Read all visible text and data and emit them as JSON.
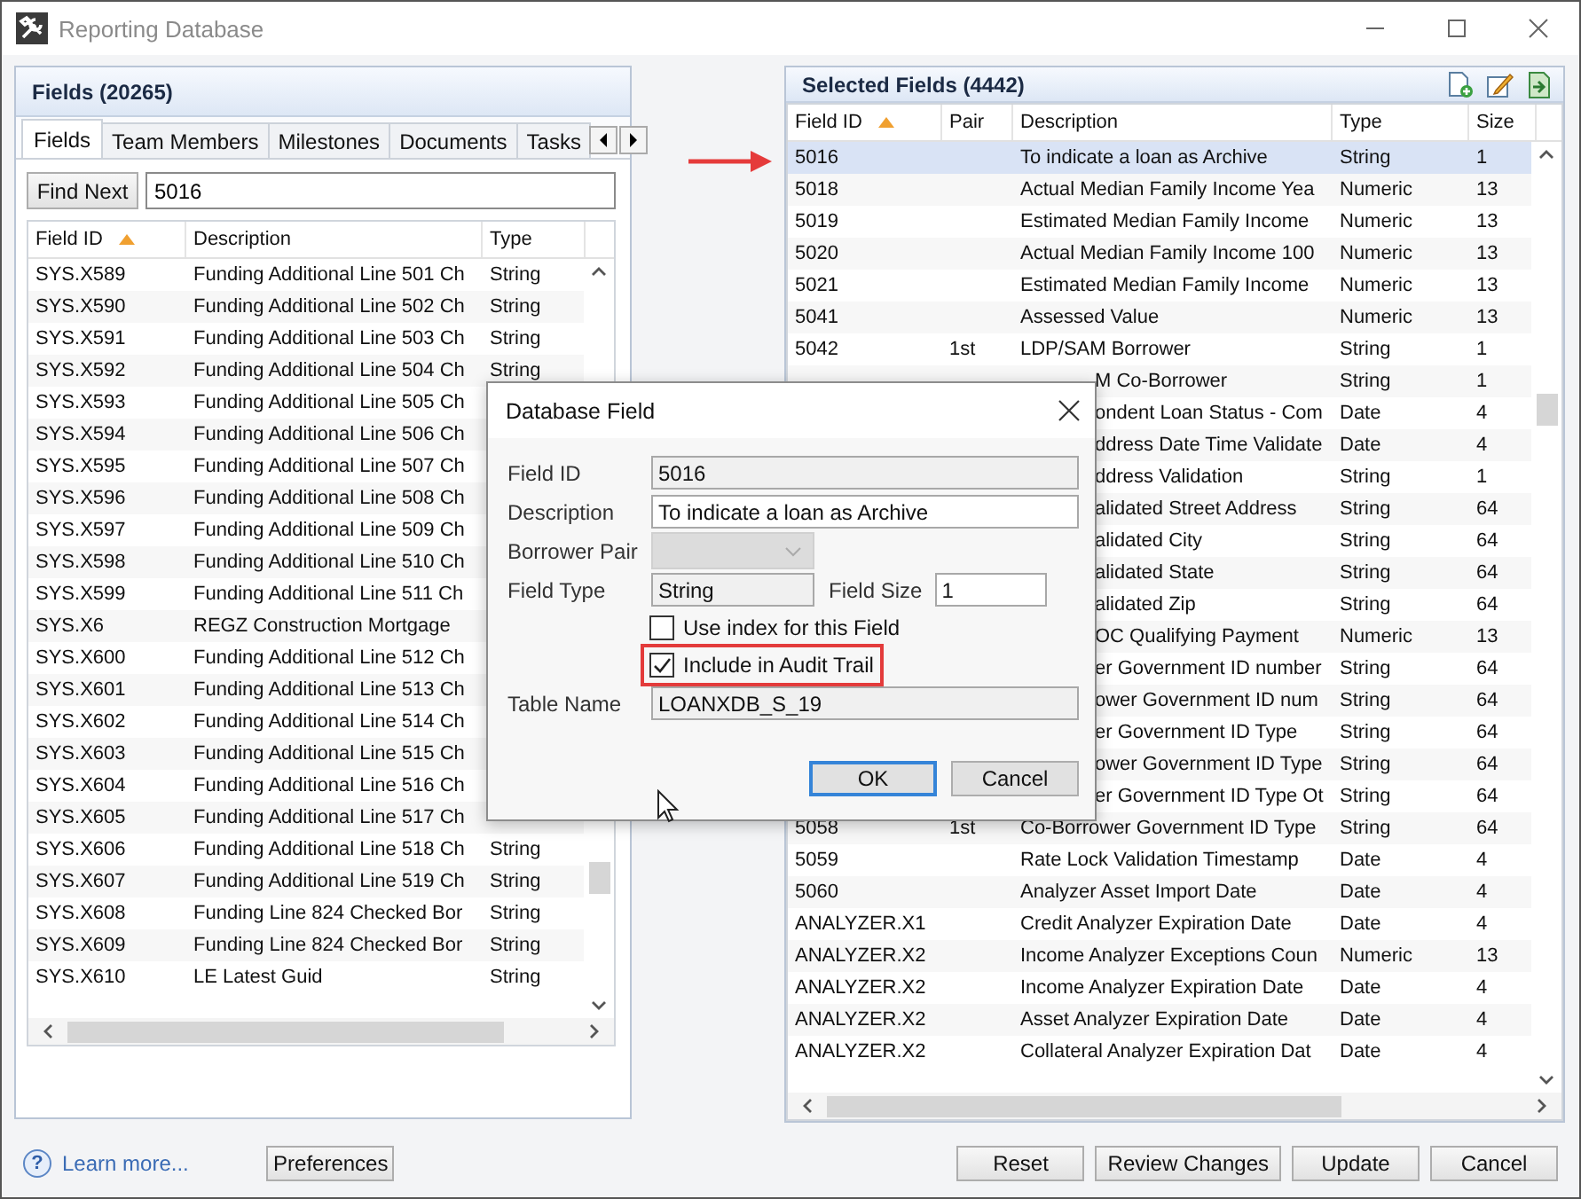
{
  "window": {
    "title": "Reporting Database"
  },
  "fields_panel": {
    "title": "Fields (20265)",
    "tabs": [
      {
        "label": "Fields",
        "selected": true
      },
      {
        "label": "Team Members",
        "selected": false
      },
      {
        "label": "Milestones",
        "selected": false
      },
      {
        "label": "Documents",
        "selected": false
      },
      {
        "label": "Tasks",
        "selected": false
      }
    ],
    "find_button": "Find Next",
    "search_value": "5016",
    "columns": [
      {
        "label": "Field ID",
        "sorted": true
      },
      {
        "label": "Description",
        "sorted": false
      },
      {
        "label": "Type",
        "sorted": false
      }
    ],
    "rows": [
      {
        "field_id": "SYS.X589",
        "description": "Funding Additional Line 501 Ch",
        "type": "String"
      },
      {
        "field_id": "SYS.X590",
        "description": "Funding Additional Line 502 Ch",
        "type": "String"
      },
      {
        "field_id": "SYS.X591",
        "description": "Funding Additional Line 503 Ch",
        "type": "String"
      },
      {
        "field_id": "SYS.X592",
        "description": "Funding Additional Line 504 Ch",
        "type": "String"
      },
      {
        "field_id": "SYS.X593",
        "description": "Funding Additional Line 505 Ch"
      },
      {
        "field_id": "SYS.X594",
        "description": "Funding Additional Line 506 Ch"
      },
      {
        "field_id": "SYS.X595",
        "description": "Funding Additional Line 507 Ch"
      },
      {
        "field_id": "SYS.X596",
        "description": "Funding Additional Line 508 Ch"
      },
      {
        "field_id": "SYS.X597",
        "description": "Funding Additional Line 509 Ch"
      },
      {
        "field_id": "SYS.X598",
        "description": "Funding Additional Line 510 Ch"
      },
      {
        "field_id": "SYS.X599",
        "description": "Funding Additional Line 511 Ch"
      },
      {
        "field_id": "SYS.X6",
        "description": "REGZ Construction Mortgage"
      },
      {
        "field_id": "SYS.X600",
        "description": "Funding Additional Line 512 Ch"
      },
      {
        "field_id": "SYS.X601",
        "description": "Funding Additional Line 513 Ch"
      },
      {
        "field_id": "SYS.X602",
        "description": "Funding Additional Line 514 Ch"
      },
      {
        "field_id": "SYS.X603",
        "description": "Funding Additional Line 515 Ch"
      },
      {
        "field_id": "SYS.X604",
        "description": "Funding Additional Line 516 Ch"
      },
      {
        "field_id": "SYS.X605",
        "description": "Funding Additional Line 517 Ch"
      },
      {
        "field_id": "SYS.X606",
        "description": "Funding Additional Line 518 Ch",
        "type": "String"
      },
      {
        "field_id": "SYS.X607",
        "description": "Funding Additional Line 519 Ch",
        "type": "String"
      },
      {
        "field_id": "SYS.X608",
        "description": "Funding Line 824 Checked Bor",
        "type": "String"
      },
      {
        "field_id": "SYS.X609",
        "description": "Funding Line 824 Checked Bor",
        "type": "String"
      },
      {
        "field_id": "SYS.X610",
        "description": "LE Latest Guid",
        "type": "String"
      }
    ]
  },
  "selected_panel": {
    "title": "Selected Fields (4442)",
    "columns": [
      {
        "label": "Field ID",
        "sorted": true
      },
      {
        "label": "Pair",
        "sorted": false
      },
      {
        "label": "Description",
        "sorted": false
      },
      {
        "label": "Type",
        "sorted": false
      },
      {
        "label": "Size",
        "sorted": false
      }
    ],
    "rows": [
      {
        "field_id": "5016",
        "description": "To indicate a loan as Archive",
        "type": "String",
        "size": "1",
        "selected": true
      },
      {
        "field_id": "5018",
        "description": "Actual Median Family Income Yea",
        "type": "Numeric",
        "size": "13",
        "selected": false
      },
      {
        "field_id": "5019",
        "description": "Estimated Median Family Income",
        "type": "Numeric",
        "size": "13",
        "selected": false
      },
      {
        "field_id": "5020",
        "description": "Actual Median Family Income 100",
        "type": "Numeric",
        "size": "13",
        "selected": false
      },
      {
        "field_id": "5021",
        "description": "Estimated Median Family Income",
        "type": "Numeric",
        "size": "13",
        "selected": false
      },
      {
        "field_id": "5041",
        "description": "Assessed Value",
        "type": "Numeric",
        "size": "13",
        "selected": false
      },
      {
        "field_id": "5042",
        "pair": "1st",
        "description": "LDP/SAM Borrower",
        "type": "String",
        "size": "1",
        "selected": false
      },
      {
        "description": "M Co-Borrower",
        "covered": true,
        "type": "String",
        "size": "1",
        "selected": false
      },
      {
        "description": "ondent Loan Status - Com",
        "covered": true,
        "type": "Date",
        "size": "4",
        "selected": false
      },
      {
        "description": "ddress Date Time Validate",
        "covered": true,
        "type": "Date",
        "size": "4",
        "selected": false
      },
      {
        "description": "ddress Validation",
        "covered": true,
        "type": "String",
        "size": "1",
        "selected": false
      },
      {
        "description": "alidated Street Address",
        "covered": true,
        "type": "String",
        "size": "64",
        "selected": false
      },
      {
        "description": "alidated City",
        "covered": true,
        "type": "String",
        "size": "64",
        "selected": false
      },
      {
        "description": "alidated State",
        "covered": true,
        "type": "String",
        "size": "64",
        "selected": false
      },
      {
        "description": "alidated Zip",
        "covered": true,
        "type": "String",
        "size": "64",
        "selected": false
      },
      {
        "description": "OC Qualifying Payment",
        "covered": true,
        "type": "Numeric",
        "size": "13",
        "selected": false
      },
      {
        "description": "er Government ID number",
        "covered": true,
        "type": "String",
        "size": "64",
        "selected": false
      },
      {
        "description": "ower Government ID num",
        "covered": true,
        "type": "String",
        "size": "64",
        "selected": false
      },
      {
        "description": "er Government ID Type",
        "covered": true,
        "type": "String",
        "size": "64",
        "selected": false
      },
      {
        "description": "ower Government ID Type",
        "covered": true,
        "type": "String",
        "size": "64",
        "selected": false
      },
      {
        "description": "er Government ID Type Ot",
        "covered": true,
        "type": "String",
        "size": "64",
        "selected": false
      },
      {
        "field_id": "5058",
        "pair": "1st",
        "description": "Co-Borrower Government ID Type",
        "type": "String",
        "size": "64",
        "selected": false
      },
      {
        "field_id": "5059",
        "description": "Rate Lock Validation Timestamp",
        "type": "Date",
        "size": "4",
        "selected": false
      },
      {
        "field_id": "5060",
        "description": "Analyzer Asset Import Date",
        "type": "Date",
        "size": "4",
        "selected": false
      },
      {
        "field_id": "ANALYZER.X1",
        "description": "Credit Analyzer Expiration Date",
        "type": "Date",
        "size": "4",
        "selected": false
      },
      {
        "field_id": "ANALYZER.X2",
        "description": "Income Analyzer Exceptions Coun",
        "type": "Numeric",
        "size": "13",
        "selected": false
      },
      {
        "field_id": "ANALYZER.X2",
        "description": "Income Analyzer Expiration Date",
        "type": "Date",
        "size": "4",
        "selected": false
      },
      {
        "field_id": "ANALYZER.X2",
        "description": "Asset Analyzer Expiration Date",
        "type": "Date",
        "size": "4",
        "selected": false
      },
      {
        "field_id": "ANALYZER.X2",
        "description": "Collateral Analyzer Expiration Dat",
        "type": "Date",
        "size": "4",
        "selected": false
      }
    ]
  },
  "dialog": {
    "title": "Database Field",
    "field_id": {
      "label": "Field ID",
      "value": "5016",
      "readonly": true
    },
    "description": {
      "label": "Description",
      "value": "To indicate a loan as Archive",
      "readonly": false
    },
    "borrower_pair": {
      "label": "Borrower Pair",
      "disabled": true
    },
    "field_type": {
      "label": "Field Type",
      "value": "String",
      "readonly": true
    },
    "field_size": {
      "label": "Field Size",
      "value": "1",
      "readonly": false
    },
    "checkboxes": [
      {
        "label": "Use index for this Field",
        "checked": false,
        "highlighted": false
      },
      {
        "label": "Include in Audit Trail",
        "checked": true,
        "highlighted": true
      }
    ],
    "table_name": {
      "label": "Table Name",
      "value": "LOANXDB_S_19",
      "readonly": true
    },
    "buttons": [
      {
        "label": "OK",
        "default": true
      },
      {
        "label": "Cancel",
        "default": false
      }
    ]
  },
  "footer": {
    "help_glyph": "?",
    "help_link": "Learn more...",
    "preferences": "Preferences",
    "buttons": [
      "Reset",
      "Review Changes",
      "Update",
      "Cancel"
    ]
  }
}
